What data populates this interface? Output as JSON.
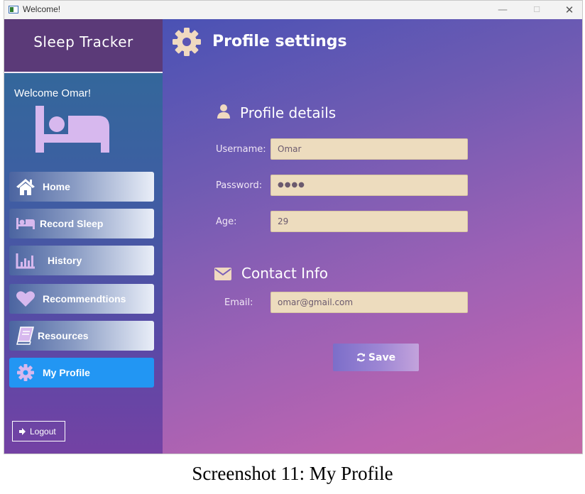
{
  "window": {
    "title": "Welcome!",
    "min_glyph": "—",
    "max_glyph": "☐",
    "close_glyph": "✕"
  },
  "sidebar": {
    "brand": "Sleep Tracker",
    "welcome": "Welcome Omar!",
    "items": [
      {
        "label": "Home",
        "icon": "home-icon"
      },
      {
        "label": "Record Sleep",
        "icon": "bed-icon"
      },
      {
        "label": "History",
        "icon": "bar-chart-icon"
      },
      {
        "label": "Recommendtions",
        "icon": "heart-icon"
      },
      {
        "label": "Resources",
        "icon": "book-icon"
      },
      {
        "label": "My Profile",
        "icon": "gear-icon",
        "active": true
      }
    ],
    "logout": "Logout"
  },
  "main": {
    "title": "Profile settings",
    "profile_section": "Profile details",
    "fields": {
      "username_label": "Username:",
      "username_value": "Omar",
      "password_label": "Password:",
      "password_value": "●●●●",
      "age_label": "Age:",
      "age_value": "29"
    },
    "contact_section": "Contact Info",
    "email_label": "Email:",
    "email_value": "omar@gmail.com",
    "save_label": "Save"
  },
  "caption": "Screenshot 11: My Profile",
  "colors": {
    "accent_active": "#2296f3",
    "field_bg": "#eddcbe",
    "icon_lavender": "#d7b8ee"
  }
}
